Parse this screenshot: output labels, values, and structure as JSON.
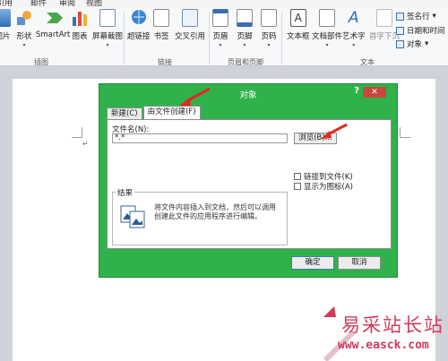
{
  "ribbon": {
    "tabs_partial": [
      "引用",
      "邮件",
      "审阅",
      "视图"
    ],
    "buttons": [
      {
        "name": "picture",
        "label": "图片",
        "icon": "picture-icon"
      },
      {
        "name": "shapes",
        "label": "形状",
        "icon": "shapes-icon"
      },
      {
        "name": "smartart",
        "label": "SmartArt",
        "icon": "smartart-icon"
      },
      {
        "name": "chart",
        "label": "图表",
        "icon": "chart-icon"
      },
      {
        "name": "screenshot",
        "label": "屏幕截图",
        "icon": "screenshot-icon"
      },
      {
        "name": "hyperlink",
        "label": "超链接",
        "icon": "hyperlink-icon"
      },
      {
        "name": "bookmark",
        "label": "书签",
        "icon": "bookmark-icon"
      },
      {
        "name": "crossref",
        "label": "交叉引用",
        "icon": "crossref-icon"
      },
      {
        "name": "header",
        "label": "页眉",
        "icon": "header-icon"
      },
      {
        "name": "footer",
        "label": "页脚",
        "icon": "footer-icon"
      },
      {
        "name": "pagenum",
        "label": "页码",
        "icon": "pagenum-icon"
      },
      {
        "name": "textbox",
        "label": "文本框",
        "icon": "textbox-icon"
      },
      {
        "name": "quickparts",
        "label": "文档部件",
        "icon": "quickparts-icon"
      },
      {
        "name": "wordart",
        "label": "艺术字",
        "icon": "wordart-icon"
      },
      {
        "name": "dropcap",
        "label": "首字下沉",
        "icon": "dropcap-icon"
      }
    ],
    "groups": {
      "illustrations": "插图",
      "links": "链接",
      "header_footer": "页眉和页脚",
      "text": "文本"
    },
    "small_commands": [
      "签名行",
      "日期和时间",
      "对象"
    ]
  },
  "document": {
    "paragraph_mark": "↵"
  },
  "dialog": {
    "title": "对象",
    "help_label": "?",
    "close_label": "✕",
    "tabs": [
      "新建(C)",
      "由文件创建(F)"
    ],
    "filename_label": "文件名(N):",
    "filename_value": "*.*",
    "browse_label": "浏览(B)...",
    "link_to_file_label": "链接到文件(K)",
    "display_as_icon_label": "显示为图标(A)",
    "result_label": "结果",
    "result_text": "将文件内容插入到文档，然后可以调用创建此文件的应用程序进行编辑。",
    "ok_label": "确定",
    "cancel_label": "取消"
  },
  "watermark": {
    "title": "易采站长站",
    "url": "www.easck.com"
  },
  "colors": {
    "dialog_frame": "#2fb24c",
    "arrow": "#e02a1f",
    "watermark": "#d23a5c"
  }
}
